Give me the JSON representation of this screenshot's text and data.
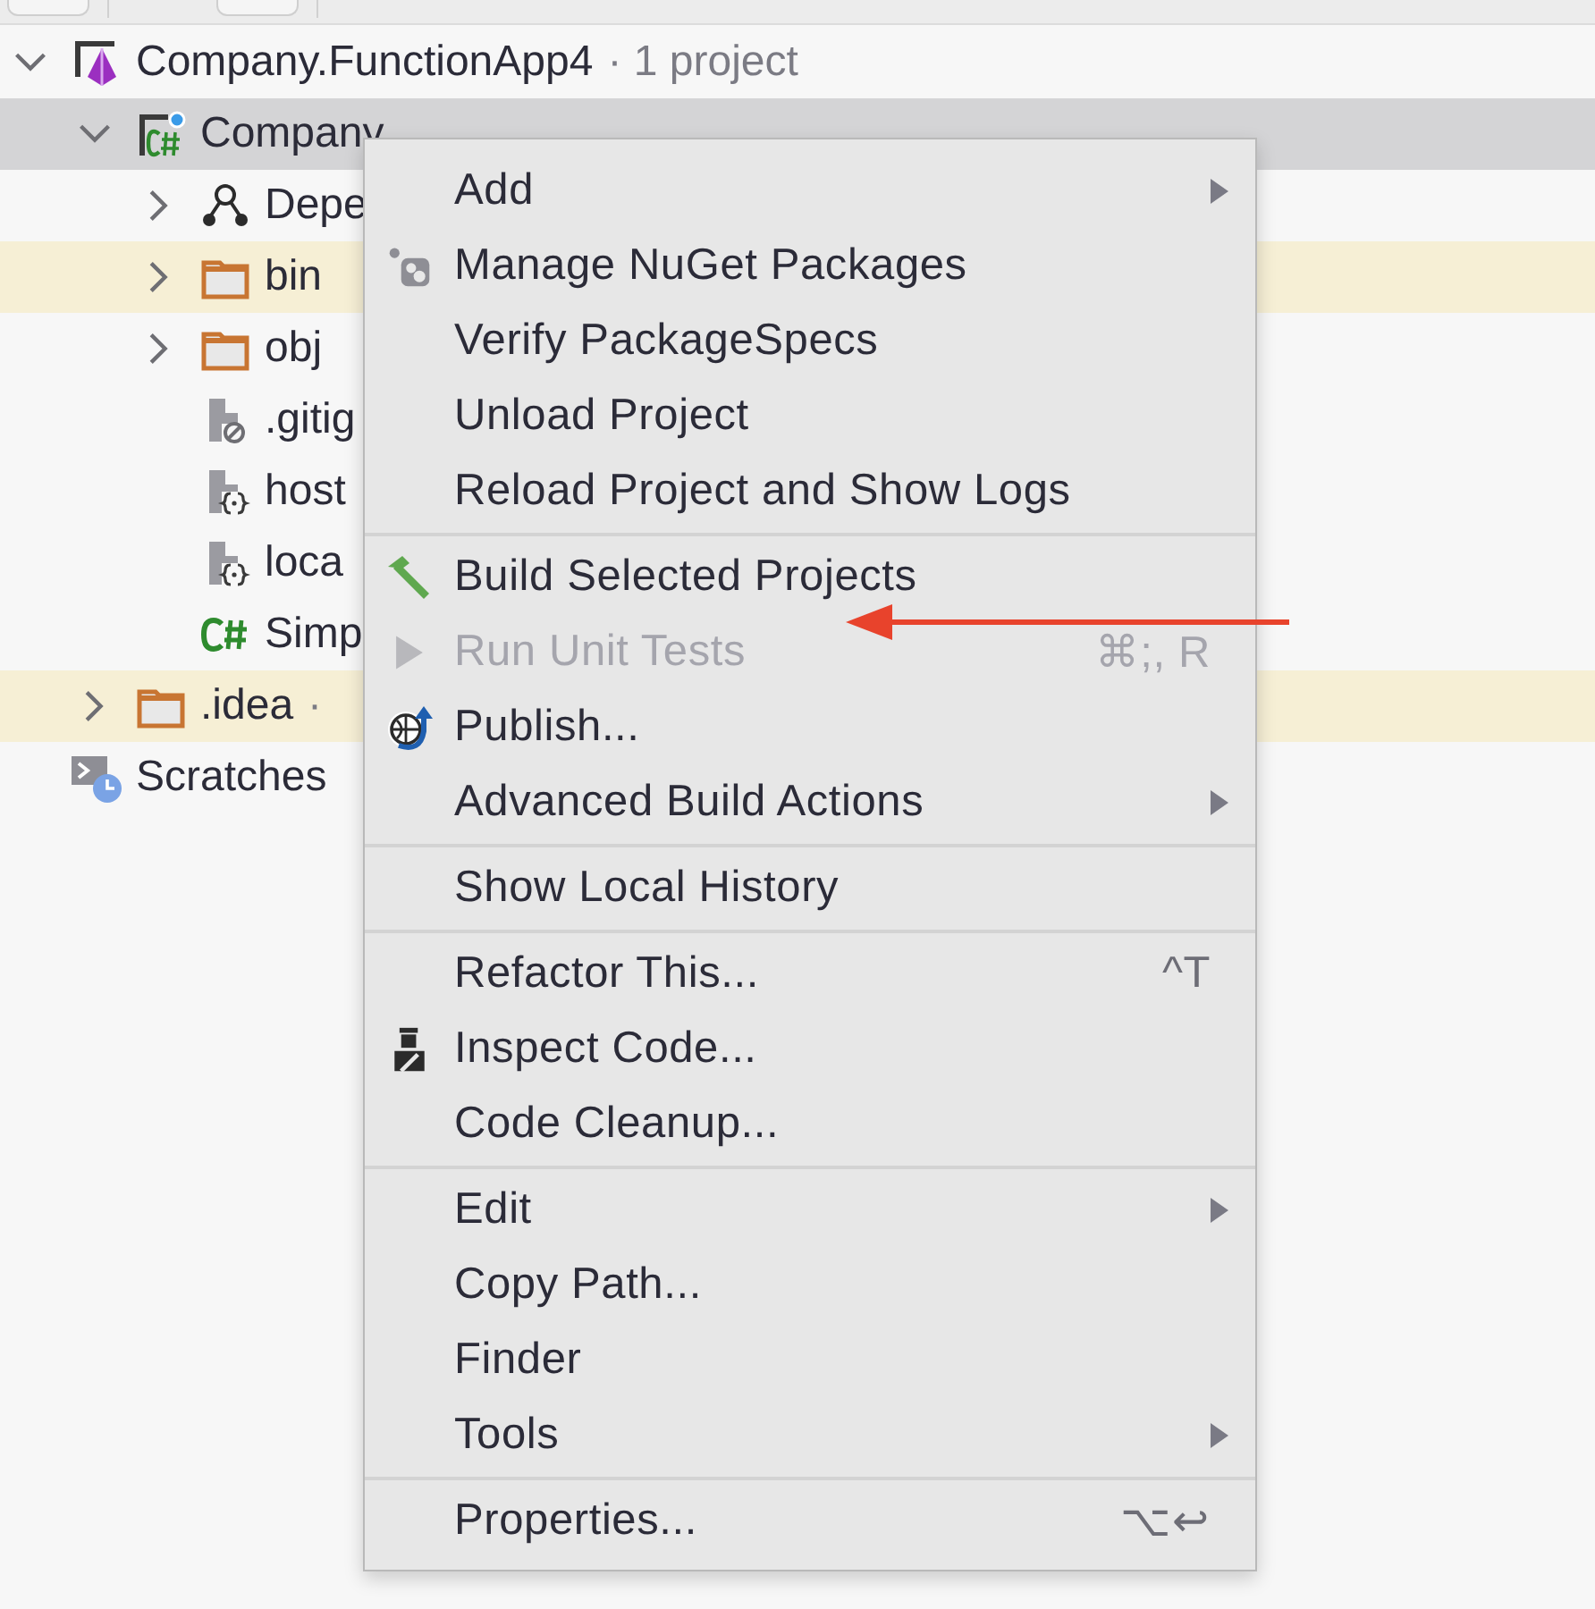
{
  "tree": [
    {
      "label": "Company.FunctionApp4",
      "suffix": "· 1 project",
      "kind": "solution",
      "expanded": true,
      "selected": false,
      "ignored": false,
      "children": [
        {
          "label": "Company",
          "kind": "csproj",
          "expanded": true,
          "selected": true,
          "ignored": false,
          "children": [
            {
              "label": "Depe",
              "kind": "deps",
              "expanded": false,
              "selected": false,
              "ignored": false
            },
            {
              "label": "bin",
              "kind": "folder",
              "expanded": false,
              "selected": false,
              "ignored": true
            },
            {
              "label": "obj",
              "kind": "folder",
              "expanded": false,
              "selected": false,
              "ignored": false
            },
            {
              "label": ".gitig",
              "kind": "ignorefile",
              "selected": false,
              "ignored": false
            },
            {
              "label": "host",
              "kind": "json",
              "selected": false,
              "ignored": false
            },
            {
              "label": "loca",
              "kind": "json",
              "selected": false,
              "ignored": false
            },
            {
              "label": "Simp",
              "kind": "cs",
              "selected": false,
              "ignored": false
            }
          ]
        },
        {
          "label": ".idea",
          "suffix": "·",
          "kind": "folder",
          "expanded": false,
          "selected": false,
          "ignored": true
        }
      ]
    },
    {
      "label": "Scratches",
      "kind": "scratches",
      "selected": false,
      "ignored": false
    }
  ],
  "context_menu": [
    {
      "kind": "item",
      "label": "Add",
      "submenu": true,
      "disabled": false
    },
    {
      "kind": "nuget",
      "label": "Manage NuGet Packages",
      "submenu": false,
      "disabled": false
    },
    {
      "kind": "item",
      "label": "Verify PackageSpecs",
      "submenu": false,
      "disabled": false
    },
    {
      "kind": "item",
      "label": "Unload Project",
      "submenu": false,
      "disabled": false
    },
    {
      "kind": "item",
      "label": "Reload Project and Show Logs",
      "submenu": false,
      "disabled": false
    },
    {
      "kind": "separator"
    },
    {
      "kind": "build",
      "label": "Build Selected Projects",
      "submenu": false,
      "disabled": false
    },
    {
      "kind": "run",
      "label": "Run Unit Tests",
      "shortcut": "⌘;, R",
      "submenu": false,
      "disabled": true
    },
    {
      "kind": "publish",
      "label": "Publish...",
      "submenu": false,
      "disabled": false
    },
    {
      "kind": "item",
      "label": "Advanced Build Actions",
      "submenu": true,
      "disabled": false
    },
    {
      "kind": "separator"
    },
    {
      "kind": "item",
      "label": "Show Local History",
      "submenu": false,
      "disabled": false
    },
    {
      "kind": "separator"
    },
    {
      "kind": "item",
      "label": "Refactor This...",
      "shortcut": "^T",
      "submenu": false,
      "disabled": false
    },
    {
      "kind": "inspect",
      "label": "Inspect Code...",
      "submenu": false,
      "disabled": false
    },
    {
      "kind": "item",
      "label": "Code Cleanup...",
      "submenu": false,
      "disabled": false
    },
    {
      "kind": "separator"
    },
    {
      "kind": "item",
      "label": "Edit",
      "submenu": true,
      "disabled": false
    },
    {
      "kind": "item",
      "label": "Copy Path...",
      "submenu": false,
      "disabled": false
    },
    {
      "kind": "item",
      "label": "Finder",
      "submenu": false,
      "disabled": false
    },
    {
      "kind": "item",
      "label": "Tools",
      "submenu": true,
      "disabled": false
    },
    {
      "kind": "separator"
    },
    {
      "kind": "item",
      "label": "Properties...",
      "shortcut": "⌥↩",
      "submenu": false,
      "disabled": false
    }
  ]
}
